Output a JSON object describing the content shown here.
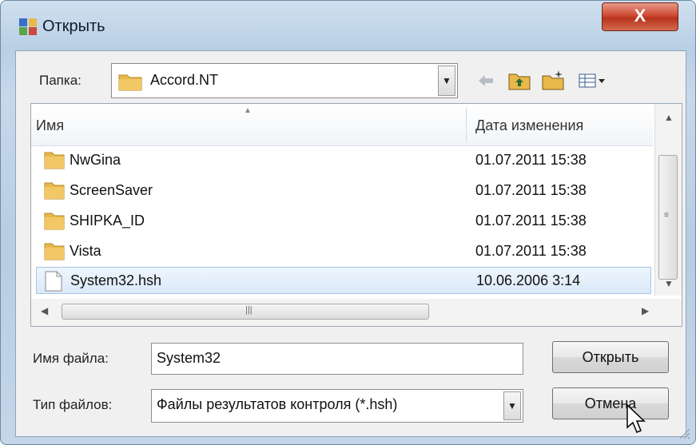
{
  "window": {
    "title": "Открыть",
    "close_label": "X"
  },
  "folder": {
    "label": "Папка:",
    "current": "Accord.NT"
  },
  "toolbar": {
    "icons": [
      "back-icon",
      "up-folder-icon",
      "new-folder-icon",
      "view-menu-icon"
    ]
  },
  "list": {
    "columns": [
      "Имя",
      "Дата изменения"
    ],
    "rows": [
      {
        "name": "NwGina",
        "date": "01.07.2011 15:38",
        "type": "folder"
      },
      {
        "name": "ScreenSaver",
        "date": "01.07.2011 15:38",
        "type": "folder"
      },
      {
        "name": "SHIPKA_ID",
        "date": "01.07.2011 15:38",
        "type": "folder"
      },
      {
        "name": "Vista",
        "date": "01.07.2011 15:38",
        "type": "folder"
      },
      {
        "name": "System32.hsh",
        "date": "10.06.2006 3:14",
        "type": "file",
        "selected": true
      }
    ]
  },
  "filename": {
    "label": "Имя файла:",
    "value": "System32"
  },
  "filetype": {
    "label": "Тип файлов:",
    "value": "Файлы результатов контроля (*.hsh)"
  },
  "buttons": {
    "open": "Открыть",
    "cancel": "Отмена"
  },
  "colors": {
    "selection": "#dbe9f8",
    "folder": "#e8b84a",
    "title_glass": "#b9cfe4"
  }
}
